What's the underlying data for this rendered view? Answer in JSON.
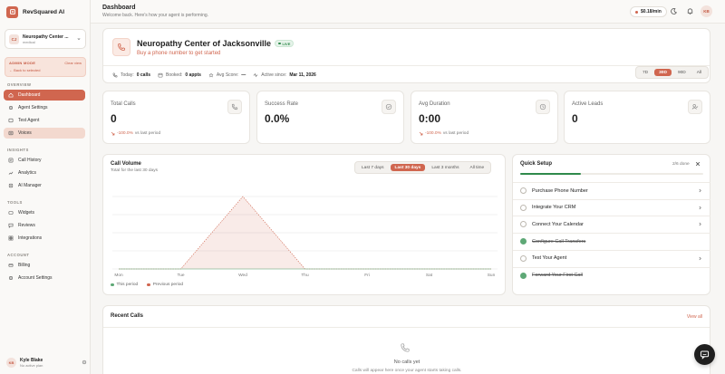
{
  "app": {
    "name": "RevSquared AI"
  },
  "colors": {
    "accent": "#d0664f",
    "accent_soft": "#f3d9cf",
    "success": "#2f8a4b"
  },
  "org": {
    "initials": "CJ",
    "name": "Neuropathy Center ...",
    "sub": "medical"
  },
  "admin": {
    "title": "ADMIN MODE",
    "clear": "Clear view",
    "back": "← Back to selected"
  },
  "sidebar": {
    "sections": {
      "overview": "OVERVIEW",
      "insights": "INSIGHTS",
      "tools": "TOOLS",
      "account": "ACCOUNT"
    },
    "items": {
      "dashboard": "Dashboard",
      "agent_settings": "Agent Settings",
      "test_agent": "Test Agent",
      "voices": "Voices",
      "call_history": "Call History",
      "analytics": "Analytics",
      "ai_manager": "AI Manager",
      "widgets": "Widgets",
      "reviews": "Reviews",
      "integrations": "Integrations",
      "billing": "Billing",
      "account_settings": "Account Settings"
    }
  },
  "user": {
    "initials": "KB",
    "name": "Kyle Blake",
    "plan": "No active plan"
  },
  "header": {
    "title": "Dashboard",
    "subtitle": "Welcome back. Here's how your agent is performing.",
    "balance": "$0.18/min",
    "avatar": "KB"
  },
  "hero": {
    "title": "Neuropathy Center of Jacksonville",
    "badge": "LIVE",
    "link": "Buy a phone number to get started",
    "stats": {
      "today_label": "Today:",
      "today_value": "0 calls",
      "booked_label": "Booked:",
      "booked_value": "0 appts",
      "score_label": "Avg Score:",
      "score_value": "—",
      "active_label": "Active since:",
      "active_value": "Mar 11, 2026"
    },
    "ranges": [
      "7D",
      "30D",
      "90D",
      "All"
    ],
    "active_range": "30D"
  },
  "stats": [
    {
      "label": "Total Calls",
      "value": "0",
      "delta": "-100.0%",
      "delta_text": "vs last period",
      "icon": "phone-icon"
    },
    {
      "label": "Success Rate",
      "value": "0.0%",
      "delta": "",
      "delta_text": "",
      "icon": "check-circle-icon"
    },
    {
      "label": "Avg Duration",
      "value": "0:00",
      "delta": "-100.0%",
      "delta_text": "vs last period",
      "icon": "clock-icon"
    },
    {
      "label": "Active Leads",
      "value": "0",
      "delta": "",
      "delta_text": "",
      "icon": "user-check-icon"
    }
  ],
  "call_volume": {
    "title": "Call Volume",
    "subtitle": "Total for the last 30 days",
    "ranges": [
      "Last 7 days",
      "Last 30 days",
      "Last 3 months",
      "All time"
    ],
    "active_range": "Last 30 days",
    "legend": {
      "this": "This period",
      "prev": "Previous period"
    }
  },
  "chart_data": {
    "type": "area",
    "categories": [
      "Mon",
      "Tue",
      "Wed",
      "Thu",
      "Fri",
      "Sat",
      "Sun"
    ],
    "series": [
      {
        "name": "This period",
        "values": [
          0,
          0,
          0,
          0,
          0,
          0,
          0
        ]
      },
      {
        "name": "Previous period",
        "values": [
          0,
          0,
          1,
          0,
          0,
          0,
          0
        ]
      }
    ],
    "ylim": [
      0,
      1
    ],
    "grid": true,
    "legend": "bottom-left"
  },
  "quick_setup": {
    "title": "Quick Setup",
    "progress": "2/6 done",
    "progress_fraction": 0.333,
    "items": [
      {
        "label": "Purchase Phone Number",
        "done": false
      },
      {
        "label": "Integrate Your CRM",
        "done": false
      },
      {
        "label": "Connect Your Calendar",
        "done": false
      },
      {
        "label": "Configure Call Transfers",
        "done": true
      },
      {
        "label": "Test Your Agent",
        "done": false
      },
      {
        "label": "Forward Your First Call",
        "done": true
      }
    ]
  },
  "recent_calls": {
    "title": "Recent Calls",
    "view_all": "View all",
    "empty": "No calls yet",
    "empty_sub": "Calls will appear here once your agent starts taking calls."
  }
}
